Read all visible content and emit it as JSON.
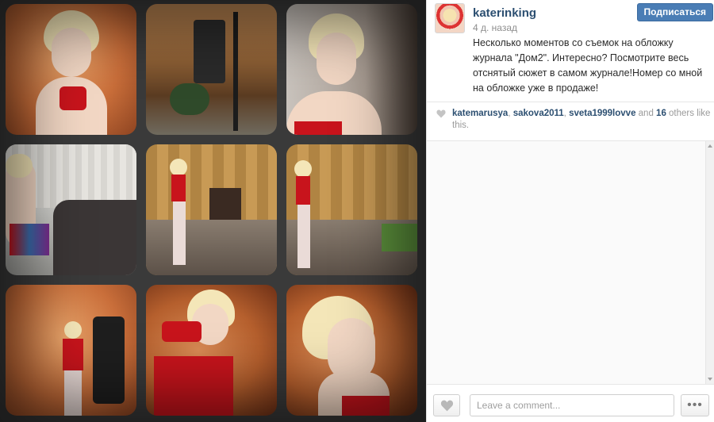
{
  "post": {
    "username": "katerinking",
    "time_ago": "4 д. назад",
    "follow_label": "Подписаться",
    "caption": "Несколько моментов со съемок на обложку журнала \"Дом2\". Интересно? Посмотрите весь отснятый сюжет в самом журнале!Номер со мной на обложке уже в продаже!"
  },
  "likes": {
    "user1": "katemarusya",
    "sep1": ", ",
    "user2": "sakova2011",
    "sep2": ", ",
    "user3": "sveta1999lovve",
    "and_text": " and ",
    "count": "16",
    "tail": " others like this."
  },
  "footer": {
    "comment_placeholder": "Leave a comment...",
    "more_label": "•••"
  },
  "colors": {
    "username": "#2c4f71",
    "follow_button": "#4a7db5",
    "like_heart": "#c4c4c4"
  },
  "icons": {
    "like": "heart-icon",
    "more": "ellipsis-icon"
  }
}
